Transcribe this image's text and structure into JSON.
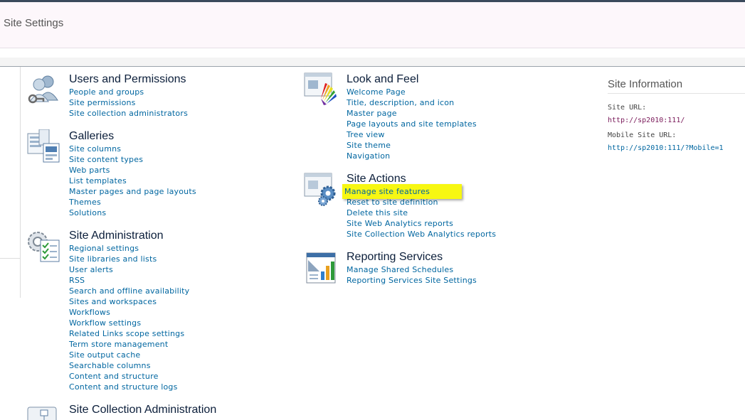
{
  "header": {
    "title": "Site Settings"
  },
  "sections": {
    "users": {
      "title": "Users and Permissions",
      "links": [
        "People and groups",
        "Site permissions",
        "Site collection administrators"
      ]
    },
    "galleries": {
      "title": "Galleries",
      "links": [
        "Site columns",
        "Site content types",
        "Web parts",
        "List templates",
        "Master pages and page layouts",
        "Themes",
        "Solutions"
      ]
    },
    "admin": {
      "title": "Site Administration",
      "links": [
        "Regional settings",
        "Site libraries and lists",
        "User alerts",
        "RSS",
        "Search and offline availability",
        "Sites and workspaces",
        "Workflows",
        "Workflow settings",
        "Related Links scope settings",
        "Term store management",
        "Site output cache",
        "Searchable columns",
        "Content and structure",
        "Content and structure logs"
      ]
    },
    "collection_admin": {
      "title": "Site Collection Administration"
    },
    "look": {
      "title": "Look and Feel",
      "links": [
        "Welcome Page",
        "Title, description, and icon",
        "Master page",
        "Page layouts and site templates",
        "Tree view",
        "Site theme",
        "Navigation"
      ]
    },
    "actions": {
      "title": "Site Actions",
      "links": [
        "Manage site features",
        "Reset to site definition",
        "Delete this site",
        "Site Web Analytics reports",
        "Site Collection Web Analytics reports"
      ]
    },
    "reporting": {
      "title": "Reporting Services",
      "links": [
        "Manage Shared Schedules",
        "Reporting Services Site Settings"
      ]
    }
  },
  "site_info": {
    "title": "Site Information",
    "site_url_label": "Site URL:",
    "site_url": "http://sp2010:111/",
    "mobile_url_label": "Mobile Site URL:",
    "mobile_url": "http://sp2010:111/?Mobile=1",
    "site_url_color": "#7a1a5a",
    "mobile_url_color": "#0066a0"
  },
  "colors": {
    "highlight": "#f7f712",
    "link": "#0066a0",
    "heading": "#0b1e3a"
  }
}
